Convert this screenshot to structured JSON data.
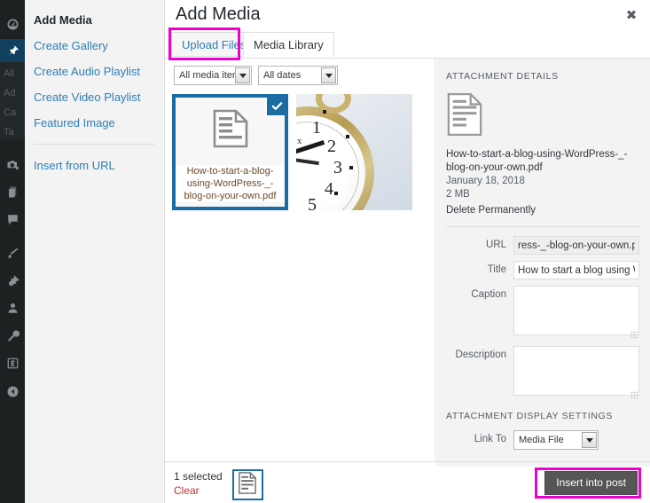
{
  "admin_sidebar": {
    "items": [
      {
        "name": "dashboard",
        "icon": "gauge-icon",
        "current": false
      },
      {
        "name": "posts",
        "icon": "pin-icon",
        "current": true
      },
      {
        "name": "media",
        "icon": "camera-icon",
        "current": false
      },
      {
        "name": "pages",
        "icon": "pages-icon",
        "current": false
      },
      {
        "name": "comments",
        "icon": "comment-icon",
        "current": false
      },
      {
        "name": "appearance",
        "icon": "paintbrush-icon",
        "current": false
      },
      {
        "name": "plugins",
        "icon": "plug-icon",
        "current": false
      },
      {
        "name": "users",
        "icon": "user-icon",
        "current": false
      },
      {
        "name": "tools",
        "icon": "wrench-icon",
        "current": false
      },
      {
        "name": "settings",
        "icon": "settings-icon",
        "current": false
      },
      {
        "name": "collapse-menu",
        "icon": "collapse-arrow-icon",
        "current": false
      }
    ],
    "submenu_labels": [
      "All",
      "Ad",
      "Ca",
      "Ta"
    ]
  },
  "media_menu": {
    "items": [
      {
        "label": "Add Media",
        "active": true
      },
      {
        "label": "Create Gallery",
        "active": false
      },
      {
        "label": "Create Audio Playlist",
        "active": false
      },
      {
        "label": "Create Video Playlist",
        "active": false
      },
      {
        "label": "Featured Image",
        "active": false
      }
    ],
    "insert_from_url": "Insert from URL"
  },
  "modal": {
    "title": "Add Media",
    "close_label": "✖"
  },
  "tabs": {
    "upload": "Upload Files",
    "library": "Media Library",
    "active": "library"
  },
  "toolbar": {
    "media_filter": "All media items",
    "date_filter": "All dates"
  },
  "attachments": [
    {
      "type": "pdf",
      "filename": "How-to-start-a-blog-using-WordPress-_-blog-on-your-own.pdf",
      "selected": true,
      "icon": "document-icon"
    },
    {
      "type": "image",
      "filename": "clock",
      "selected": false,
      "icon": "clock-photo"
    }
  ],
  "clock_photo": {
    "numerals": [
      "1",
      "2",
      "3",
      "4",
      "5"
    ],
    "partial_text": "x"
  },
  "details": {
    "heading": "ATTACHMENT DETAILS",
    "icon": "document-icon",
    "filename": "How-to-start-a-blog-using-WordPress-_-blog-on-your-own.pdf",
    "date": "January 18, 2018",
    "filesize": "2 MB",
    "delete_label": "Delete Permanently"
  },
  "fields": {
    "url_label": "URL",
    "url_value": "ress-_-blog-on-your-own.pdf",
    "title_label": "Title",
    "title_value": "How to start a blog using Wor",
    "caption_label": "Caption",
    "caption_value": "",
    "description_label": "Description",
    "description_value": ""
  },
  "display_settings": {
    "heading": "ATTACHMENT DISPLAY SETTINGS",
    "link_to_label": "Link To",
    "link_to_value": "Media File"
  },
  "footer": {
    "selected_count": "1 selected",
    "clear_label": "Clear",
    "thumb_icon": "document-icon",
    "insert_label": "Insert into post"
  },
  "highlights": {
    "color": "#ee00cc",
    "targets": [
      "upload-files-tab",
      "insert-into-post-button"
    ]
  }
}
